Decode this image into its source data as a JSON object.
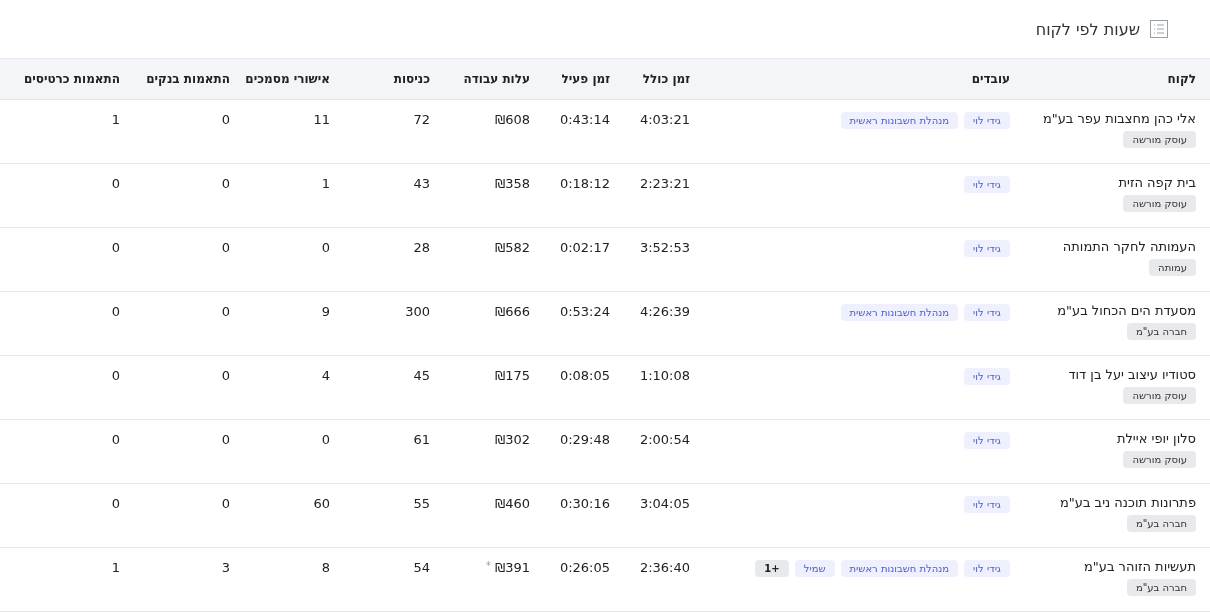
{
  "header": {
    "title": "שעות לפי לקוח"
  },
  "table": {
    "columns": [
      "לקוח",
      "עובדים",
      "זמן כולל",
      "זמן פעיל",
      "עלות עבודה",
      "כניסות",
      "אישורי מסמכים",
      "התאמות בנקים",
      "התאמות כרטיסים"
    ],
    "rows": [
      {
        "customer": "אלי כהן מחצבות עפר בע\"מ",
        "type": "עוסק מורשה",
        "employees": [
          {
            "label": "גידי לוי",
            "kind": "person"
          },
          {
            "label": "מנהלת חשבונות ראשית",
            "kind": "person"
          }
        ],
        "total": "4:03:21",
        "active": "0:43:14",
        "cost": "₪608",
        "entries": "72",
        "docs": "11",
        "banks": "0",
        "cards": "1"
      },
      {
        "customer": "בית קפה הזית",
        "type": "עוסק מורשה",
        "employees": [
          {
            "label": "גידי לוי",
            "kind": "person"
          }
        ],
        "total": "2:23:21",
        "active": "0:18:12",
        "cost": "₪358",
        "entries": "43",
        "docs": "1",
        "banks": "0",
        "cards": "0"
      },
      {
        "customer": "העמותה לחקר התמותה",
        "type": "עמותה",
        "employees": [
          {
            "label": "גידי לוי",
            "kind": "person"
          }
        ],
        "total": "3:52:53",
        "active": "0:02:17",
        "cost": "₪582",
        "entries": "28",
        "docs": "0",
        "banks": "0",
        "cards": "0"
      },
      {
        "customer": "מסעדת הים הכחול בע\"מ",
        "type": "חברה בע\"מ",
        "employees": [
          {
            "label": "גידי לוי",
            "kind": "person"
          },
          {
            "label": "מנהלת חשבונות ראשית",
            "kind": "person"
          }
        ],
        "total": "4:26:39",
        "active": "0:53:24",
        "cost": "₪666",
        "entries": "300",
        "docs": "9",
        "banks": "0",
        "cards": "0"
      },
      {
        "customer": "סטודיו עיצוב יעל בן דוד",
        "type": "עוסק מורשה",
        "employees": [
          {
            "label": "גידי לוי",
            "kind": "person"
          }
        ],
        "total": "1:10:08",
        "active": "0:08:05",
        "cost": "₪175",
        "entries": "45",
        "docs": "4",
        "banks": "0",
        "cards": "0"
      },
      {
        "customer": "סלון יופי איילת",
        "type": "עוסק מורשה",
        "employees": [
          {
            "label": "גידי לוי",
            "kind": "person"
          }
        ],
        "total": "2:00:54",
        "active": "0:29:48",
        "cost": "₪302",
        "entries": "61",
        "docs": "0",
        "banks": "0",
        "cards": "0"
      },
      {
        "customer": "פתרונות תוכנה ניב בע\"מ",
        "type": "חברה בע\"מ",
        "employees": [
          {
            "label": "גידי לוי",
            "kind": "person"
          }
        ],
        "total": "3:04:05",
        "active": "0:30:16",
        "cost": "₪460",
        "entries": "55",
        "docs": "60",
        "banks": "0",
        "cards": "0"
      },
      {
        "customer": "תעשיות הזוהר בע\"מ",
        "type": "חברה בע\"מ",
        "employees": [
          {
            "label": "גידי לוי",
            "kind": "person"
          },
          {
            "label": "מנהלת חשבונות ראשית",
            "kind": "person"
          },
          {
            "label": "שמיל",
            "kind": "person"
          },
          {
            "label": "+1",
            "kind": "more"
          }
        ],
        "total": "2:36:40",
        "active": "0:26:05",
        "cost": "₪391",
        "cost_note": "*",
        "entries": "54",
        "docs": "8",
        "banks": "3",
        "cards": "1"
      }
    ]
  }
}
